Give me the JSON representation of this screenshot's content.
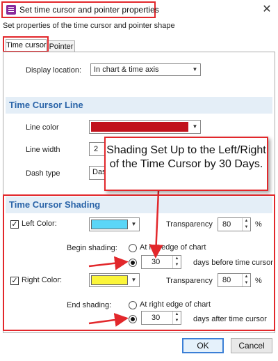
{
  "dialog": {
    "title": "Set time cursor and pointer properties",
    "subtitle": "Set properties of the time cursor and pointer shape",
    "close_glyph": "✕"
  },
  "tabs": [
    {
      "label": "Time cursor",
      "active": true
    },
    {
      "label": "Pointer",
      "active": false
    }
  ],
  "display_location": {
    "label": "Display location:",
    "value": "In chart & time axis"
  },
  "time_cursor_line": {
    "title": "Time Cursor Line",
    "line_color_label": "Line color",
    "line_color": "#c1121c",
    "line_width_label": "Line width",
    "line_width_value": "2",
    "dash_type_label": "Dash type",
    "dash_type_value": "Das"
  },
  "shading": {
    "title": "Time Cursor Shading",
    "left": {
      "checkbox_label": "Left Color:",
      "checked": true,
      "color": "#5bd6f7",
      "transparency_label": "Transparency",
      "transparency_value": "80",
      "percent": "%",
      "begin_label": "Begin shading:",
      "option_edge": "At left edge of chart",
      "option_days_value": "30",
      "days_suffix": "days before time cursor"
    },
    "right": {
      "checkbox_label": "Right Color:",
      "checked": true,
      "color": "#fbf53a",
      "transparency_label": "Transparency",
      "transparency_value": "80",
      "percent": "%",
      "end_label": "End shading:",
      "option_edge": "At right edge of chart",
      "option_days_value": "30",
      "days_suffix": "days after time cursor"
    }
  },
  "callout": {
    "text": "Shading Set Up to the Left/Right of the Time Cursor by 30 Days."
  },
  "buttons": {
    "ok": "OK",
    "cancel": "Cancel"
  },
  "colors": {
    "annotation_red": "#e2272b",
    "section_title": "#2a64a8",
    "section_band": "#e4eef7"
  }
}
